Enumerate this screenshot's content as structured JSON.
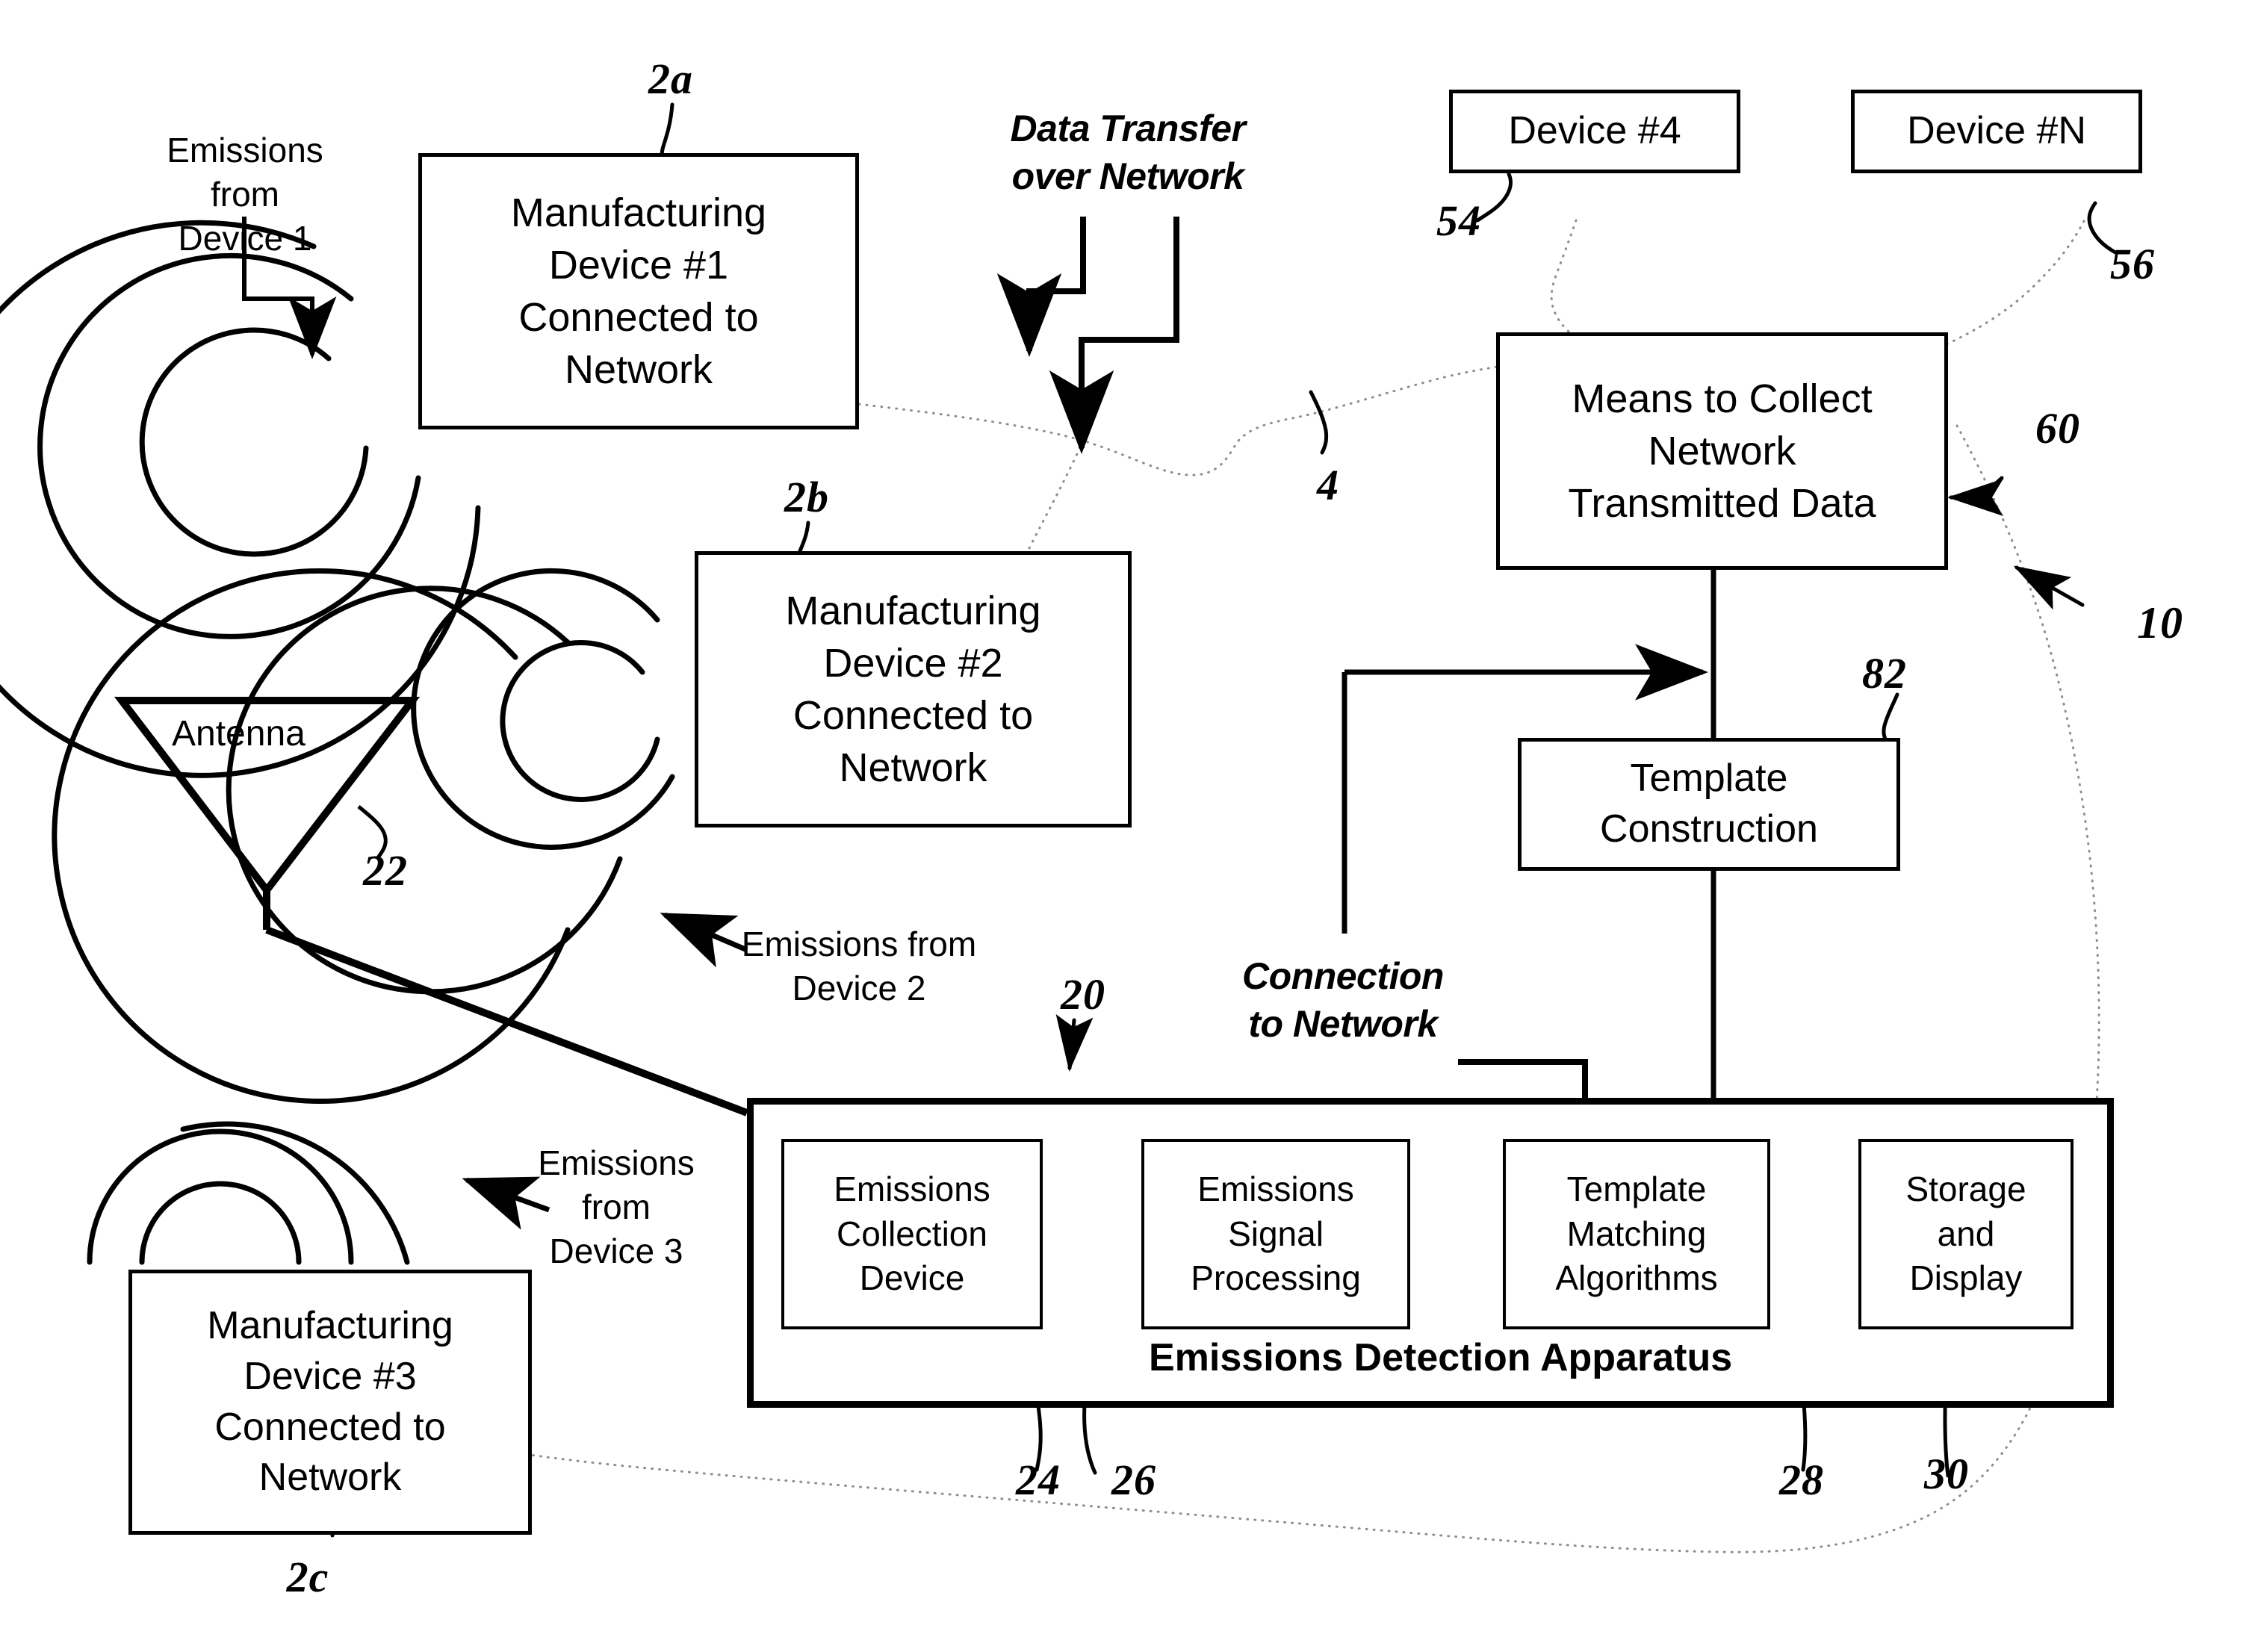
{
  "figure": {
    "title": "Emissions Detection System Block Diagram"
  },
  "boxes": {
    "mfg_device_1": "Manufacturing\nDevice #1\nConnected to\nNetwork",
    "mfg_device_2": "Manufacturing\nDevice #2\nConnected to\nNetwork",
    "mfg_device_3": "Manufacturing\nDevice #3\nConnected to\nNetwork",
    "device_4": "Device #4",
    "device_n": "Device #N",
    "means_collect": "Means to Collect\nNetwork\nTransmitted Data",
    "template_construction": "Template\nConstruction",
    "emissions_collection_device": "Emissions\nCollection\nDevice",
    "emissions_signal_processing": "Emissions\nSignal\nProcessing",
    "template_matching_algorithms": "Template\nMatching\nAlgorithms",
    "storage_and_display": "Storage\nand\nDisplay",
    "apparatus_title": "Emissions Detection Apparatus",
    "antenna": "Antenna"
  },
  "labels": {
    "emissions_from_device_1": "Emissions\nfrom\nDevice 1",
    "emissions_from_device_2": "Emissions from\nDevice 2",
    "emissions_from_device_3": "Emissions\nfrom\nDevice 3",
    "data_transfer_over_network": "Data Transfer\nover Network",
    "connection_to_network": "Connection\nto Network"
  },
  "reference_numerals": {
    "n_2a": "2a",
    "n_2b": "2b",
    "n_2c": "2c",
    "n_4": "4",
    "n_10": "10",
    "n_20": "20",
    "n_22": "22",
    "n_24": "24",
    "n_26": "26",
    "n_28": "28",
    "n_30": "30",
    "n_54": "54",
    "n_56": "56",
    "n_60": "60",
    "n_82": "82"
  },
  "colors": {
    "ink": "#000000",
    "paper": "#ffffff",
    "network_path": "#909090"
  }
}
